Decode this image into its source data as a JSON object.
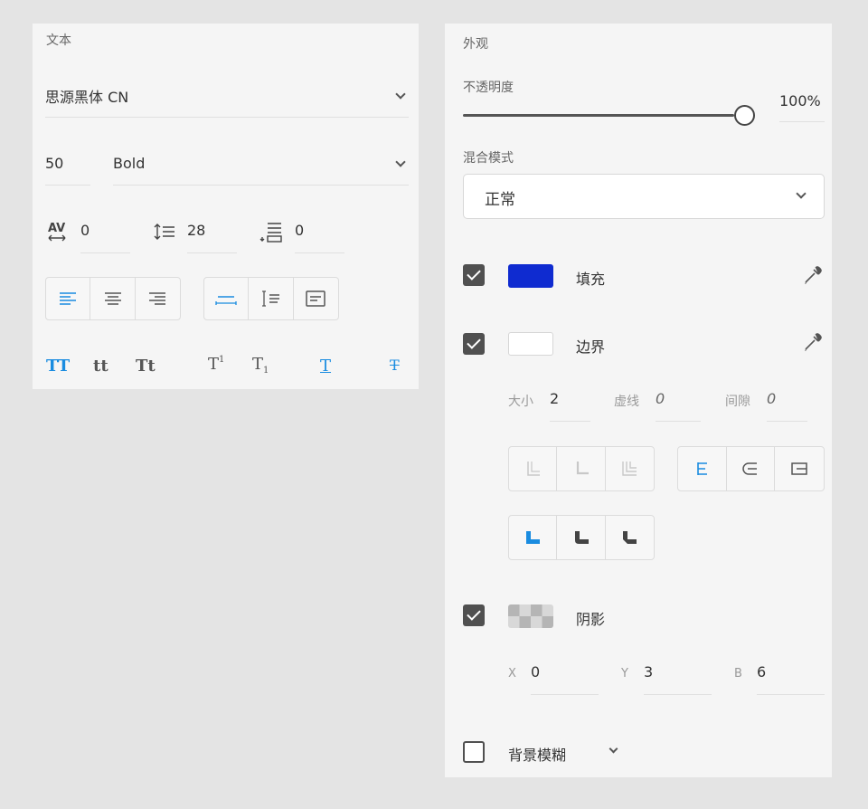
{
  "text_panel": {
    "title": "文本",
    "font_family": "思源黑体 CN",
    "font_size": "50",
    "font_weight": "Bold",
    "char_spacing": "0",
    "line_spacing": "28",
    "paragraph_spacing": "0",
    "transforms": {
      "uppercase": "TT",
      "lowercase": "tt",
      "titlecase": "Tt",
      "superscript": "T",
      "superscript_mark": "1",
      "subscript": "T",
      "subscript_mark": "1",
      "underline": "T",
      "strikethrough": "T"
    }
  },
  "appearance_panel": {
    "title": "外观",
    "opacity_label": "不透明度",
    "opacity_value": "100%",
    "opacity_level": 1.0,
    "blend_label": "混合模式",
    "blend_value": "正常",
    "fill": {
      "checked": true,
      "label": "填充",
      "color": "#0f2bd0"
    },
    "border": {
      "checked": true,
      "label": "边界",
      "color": "#ffffff",
      "size_label": "大小",
      "size": "2",
      "dash_label": "虚线",
      "dash": "0",
      "gap_label": "间隙",
      "gap": "0"
    },
    "shadow": {
      "checked": true,
      "label": "阴影",
      "x_label": "X",
      "x": "0",
      "y_label": "Y",
      "y": "3",
      "b_label": "B",
      "b": "6"
    },
    "bg_blur": {
      "checked": false,
      "label": "背景模糊"
    }
  },
  "colors": {
    "accent": "#1a8ce0",
    "icon": "#555555",
    "disabled_icon": "#c8c8c8"
  }
}
